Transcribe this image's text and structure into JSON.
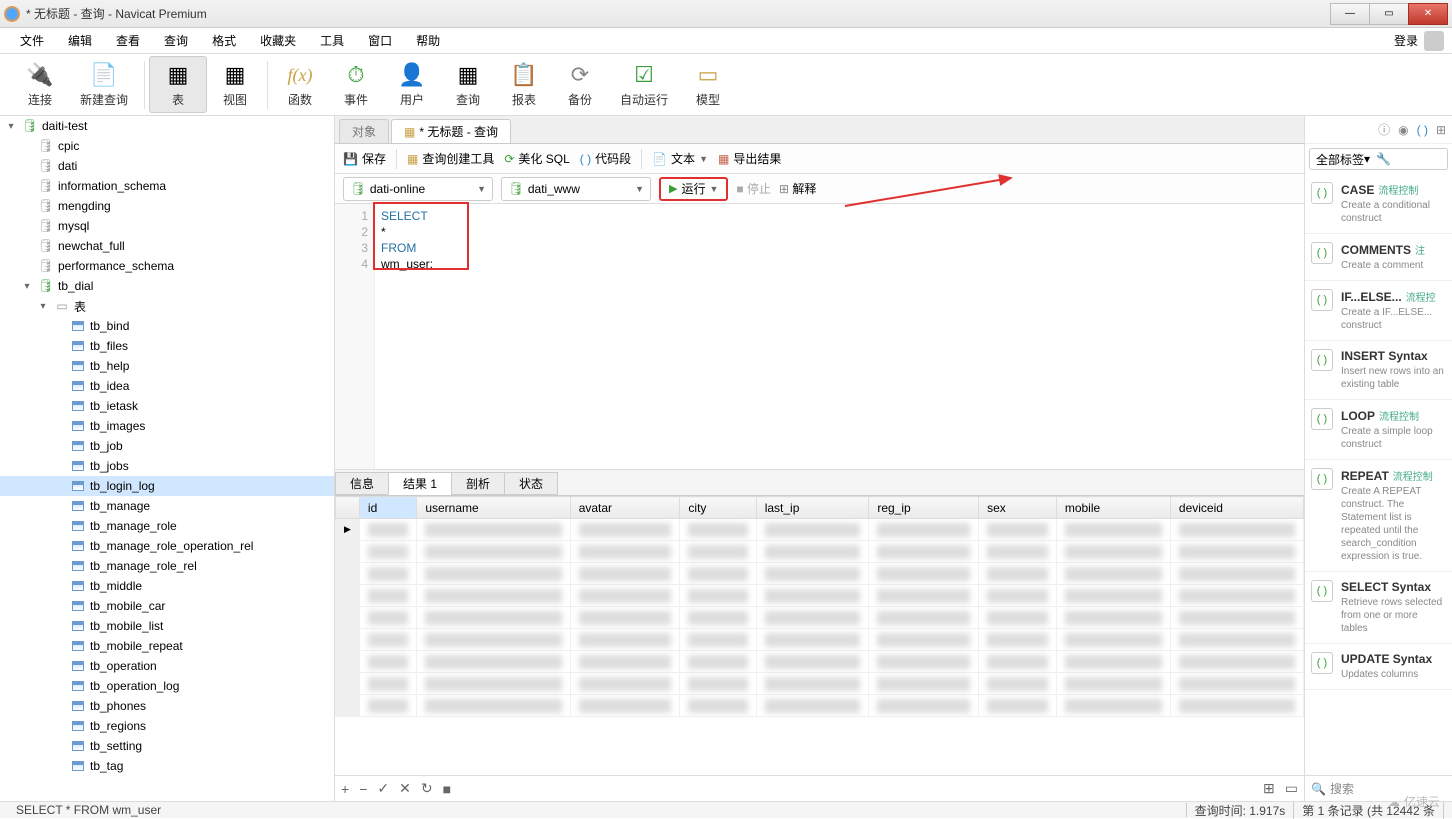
{
  "window": {
    "title": "* 无标题 - 查询 - Navicat Premium"
  },
  "menubar": {
    "items": [
      "文件",
      "编辑",
      "查看",
      "查询",
      "格式",
      "收藏夹",
      "工具",
      "窗口",
      "帮助"
    ],
    "login": "登录"
  },
  "toolbar": {
    "items": [
      {
        "label": "连接",
        "glyph": "🔌"
      },
      {
        "label": "新建查询",
        "glyph": "📄"
      },
      {
        "label": "表",
        "glyph": "▦",
        "active": true
      },
      {
        "label": "视图",
        "glyph": "▦"
      },
      {
        "label": "函数",
        "glyph": "f(x)",
        "color": "#c9a043",
        "italic": true
      },
      {
        "label": "事件",
        "glyph": "⏱",
        "color": "#3a9d3a"
      },
      {
        "label": "用户",
        "glyph": "👤"
      },
      {
        "label": "查询",
        "glyph": "▦"
      },
      {
        "label": "报表",
        "glyph": "📋"
      },
      {
        "label": "备份",
        "glyph": "⟳",
        "color": "#888"
      },
      {
        "label": "自动运行",
        "glyph": "☑",
        "color": "#3a9d3a"
      },
      {
        "label": "模型",
        "glyph": "▭",
        "color": "#c9a043"
      }
    ]
  },
  "tree": {
    "root": {
      "label": "daiti-test"
    },
    "databases": [
      "cpic",
      "dati",
      "information_schema",
      "mengding",
      "mysql",
      "newchat_full",
      "performance_schema"
    ],
    "active_db": "tb_dial",
    "tables_label": "表",
    "tables": [
      "tb_bind",
      "tb_files",
      "tb_help",
      "tb_idea",
      "tb_ietask",
      "tb_images",
      "tb_job",
      "tb_jobs",
      "tb_login_log",
      "tb_manage",
      "tb_manage_role",
      "tb_manage_role_operation_rel",
      "tb_manage_role_rel",
      "tb_middle",
      "tb_mobile_car",
      "tb_mobile_list",
      "tb_mobile_repeat",
      "tb_operation",
      "tb_operation_log",
      "tb_phones",
      "tb_regions",
      "tb_setting",
      "tb_tag"
    ],
    "selected_table": "tb_login_log"
  },
  "tabs": {
    "objects": "对象",
    "query": "* 无标题 - 查询"
  },
  "subtoolbar": {
    "save": "保存",
    "builder": "查询创建工具",
    "beautify": "美化 SQL",
    "snippet": "代码段",
    "text": "文本",
    "export": "导出结果"
  },
  "context": {
    "connection": "dati-online",
    "schema": "dati_www",
    "run": "运行",
    "stop": "停止",
    "explain": "解释"
  },
  "sql": {
    "lines": [
      "SELECT",
      "    *",
      "FROM",
      "    wm_user;"
    ]
  },
  "result_tabs": {
    "info": "信息",
    "result": "结果 1",
    "profile": "剖析",
    "status": "状态"
  },
  "grid": {
    "columns": [
      "id",
      "username",
      "avatar",
      "city",
      "last_ip",
      "reg_ip",
      "sex",
      "mobile",
      "deviceid"
    ]
  },
  "statusbar": {
    "sql": "SELECT    *  FROM   wm_user",
    "time_label": "查询时间:",
    "time": "1.917s",
    "count": "第 1 条记录 (共 12442 条"
  },
  "right": {
    "tag_filter": "全部标签",
    "search": "搜索",
    "snippets": [
      {
        "title": "CASE",
        "tag": "流程控制",
        "desc": "Create a conditional construct"
      },
      {
        "title": "COMMENTS",
        "tag": "注",
        "desc": "Create a comment"
      },
      {
        "title": "IF...ELSE...",
        "tag": "流程控",
        "desc": "Create a IF...ELSE... construct"
      },
      {
        "title": "INSERT Syntax",
        "tag": "",
        "desc": "Insert new rows into an existing table"
      },
      {
        "title": "LOOP",
        "tag": "流程控制",
        "desc": "Create a simple loop construct"
      },
      {
        "title": "REPEAT",
        "tag": "流程控制",
        "desc": "Create A REPEAT construct. The Statement list is repeated until the search_condition expression is true."
      },
      {
        "title": "SELECT Syntax",
        "tag": "",
        "desc": "Retrieve rows selected from one or more tables"
      },
      {
        "title": "UPDATE Syntax",
        "tag": "",
        "desc": "Updates columns"
      }
    ]
  },
  "watermark": "亿速云"
}
